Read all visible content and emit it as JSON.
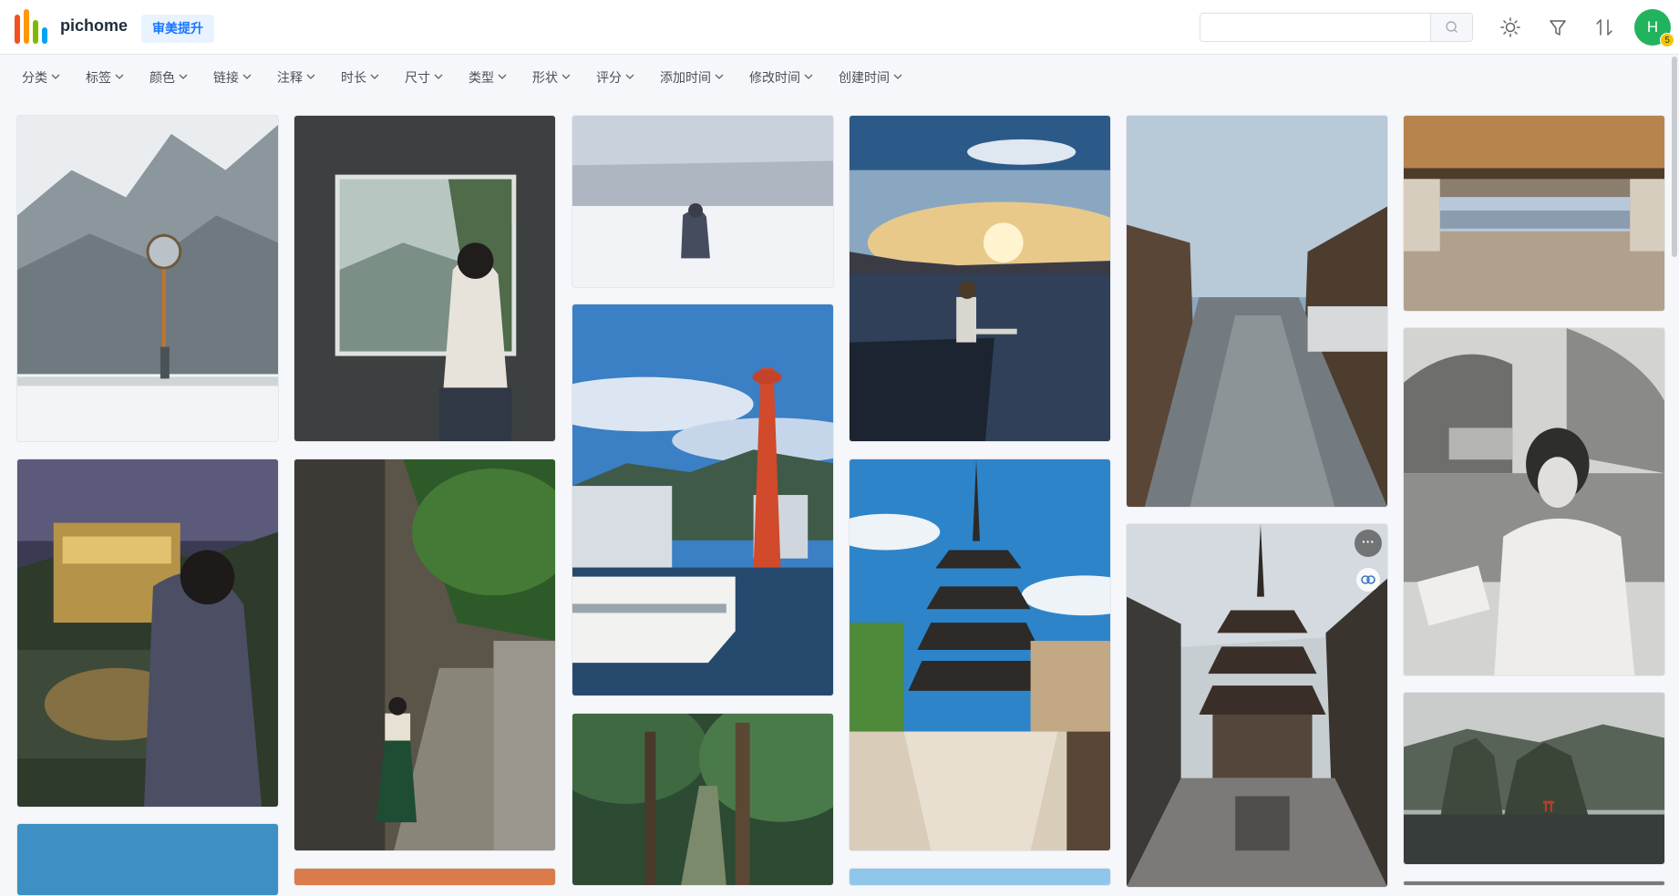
{
  "app": {
    "name": "pichome",
    "upgrade_label": "审美提升",
    "logo_colors": [
      "#f25022",
      "#ff9900",
      "#7fba00",
      "#00a4ef"
    ]
  },
  "search": {
    "placeholder": "",
    "value": "",
    "icon": "search-icon"
  },
  "toolbar": {
    "icons": [
      "theme-icon",
      "filter-icon",
      "sort-icon"
    ]
  },
  "user": {
    "avatar_letter": "H",
    "badge_count": "5",
    "avatar_color": "#22b35e"
  },
  "filters": [
    "分类",
    "标签",
    "颜色",
    "链接",
    "注释",
    "时长",
    "尺寸",
    "类型",
    "形状",
    "评分",
    "添加时间",
    "修改时间",
    "创建时间"
  ],
  "gallery": {
    "tiles": [
      {
        "subject": "snowy mountain road with figure"
      },
      {
        "subject": "woman at window"
      },
      {
        "subject": "person standing in snowfield"
      },
      {
        "subject": "sunset over water with seated figure"
      },
      {
        "subject": "old town street with stairs"
      },
      {
        "subject": "wooden pavilion overlooking city"
      },
      {
        "subject": "golden pavilion and woman"
      },
      {
        "subject": "woman in alley with trees"
      },
      {
        "subject": "harbor with red tower and ferry"
      },
      {
        "subject": "pagoda above old street"
      },
      {
        "subject": "pagoda seen from narrow street"
      },
      {
        "subject": "monochrome portrait with temple"
      },
      {
        "subject": "sky"
      },
      {
        "subject": "sunset"
      },
      {
        "subject": "forest path"
      },
      {
        "subject": "sky"
      },
      {
        "subject": "coastal rocks with torii"
      }
    ],
    "hover_more_label": "···"
  },
  "colors": {
    "accent": "#1677ff",
    "badge": "#f5c400"
  }
}
